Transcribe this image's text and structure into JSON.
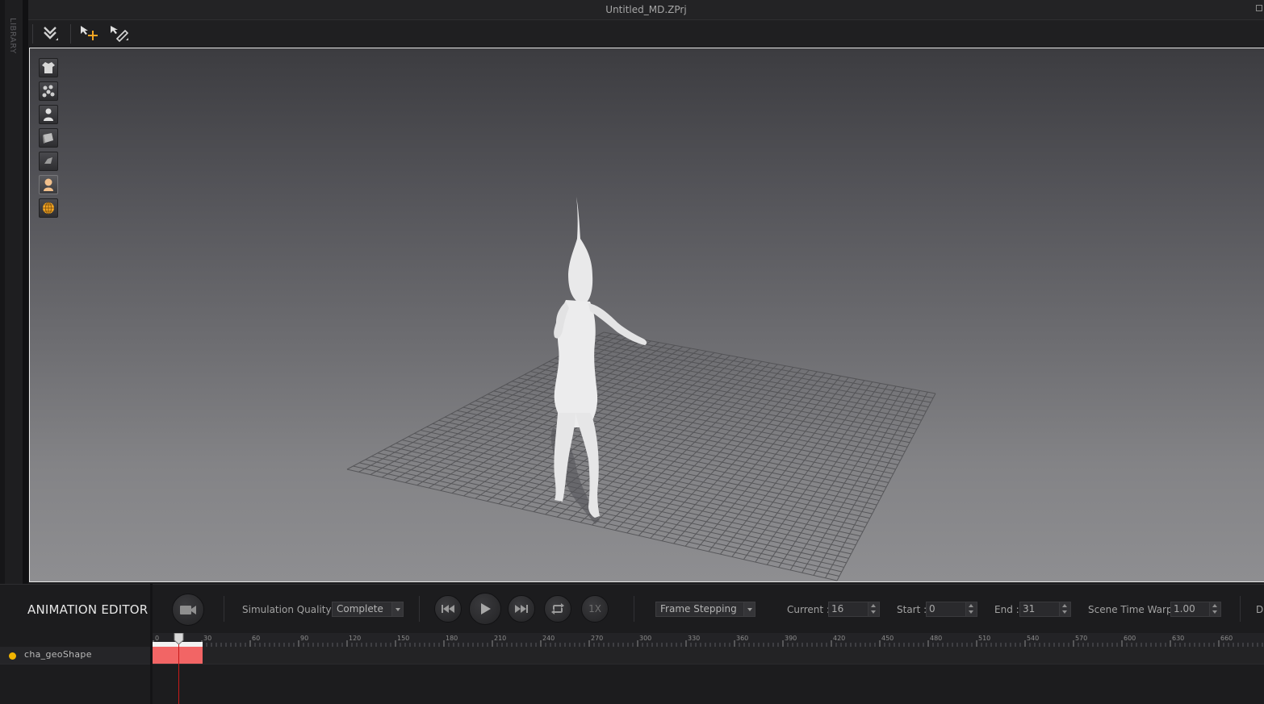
{
  "window": {
    "title": "Untitled_MD.ZPrj",
    "library_label": "LIBRARY"
  },
  "toolbar": {
    "tools": [
      "import-icon",
      "transform-move-icon",
      "edit-brush-icon"
    ]
  },
  "viewport_tools": [
    "garment-icon",
    "particles-icon",
    "avatar-icon",
    "fabric-icon",
    "texture-icon",
    "avatar-skin-icon",
    "globe-grid-icon"
  ],
  "animation_editor": {
    "title": "ANIMATION EDITOR",
    "simulation_quality_label": "Simulation Quality",
    "simulation_quality_value": "Complete",
    "speed_label": "1X",
    "frame_mode_value": "Frame Stepping",
    "current_label": "Current :",
    "current_value": "16",
    "start_label": "Start :",
    "start_value": "0",
    "end_label": "End :",
    "end_value": "31",
    "time_warp_label": "Scene Time Warp",
    "time_warp_value": "1.00",
    "cut_label": "D"
  },
  "timeline": {
    "ruler_labels": [
      "0",
      "30",
      "60",
      "90",
      "120",
      "150",
      "180",
      "210",
      "240",
      "270",
      "300",
      "330",
      "360",
      "390",
      "420",
      "450",
      "480",
      "510",
      "540",
      "570",
      "600",
      "630",
      "660"
    ],
    "current_frame": 16,
    "range_start": 0,
    "range_end": 31,
    "tracks": [
      {
        "name": "cha_geoShape",
        "color": "#f2b400"
      }
    ]
  },
  "colors": {
    "accent_orange": "#f5a623",
    "clip_red": "#f26565",
    "playhead": "#c81a1a"
  }
}
